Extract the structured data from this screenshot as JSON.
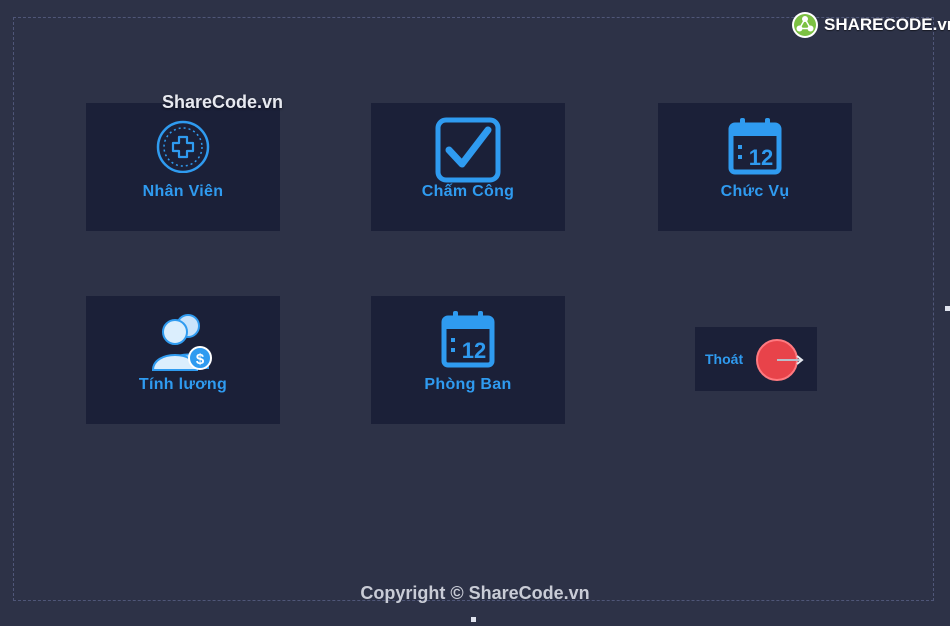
{
  "watermark": "ShareCode.vn",
  "logo": {
    "text": "SHARECODE.vn",
    "icon": "sharecode-logo-icon"
  },
  "tiles": [
    {
      "label": "Nhân Viên",
      "icon": "add-circle-icon"
    },
    {
      "label": "Chấm Công",
      "icon": "checkbox-icon"
    },
    {
      "label": "Chức Vụ",
      "icon": "calendar-icon"
    },
    {
      "label": "Tính lương",
      "icon": "users-salary-icon"
    },
    {
      "label": "Phòng Ban",
      "icon": "calendar-icon"
    }
  ],
  "calendar_day": "12",
  "exit": {
    "label": "Thoát",
    "icon": "exit-icon"
  },
  "copyright": "Copyright © ShareCode.vn",
  "colors": {
    "background": "#2d3247",
    "tile": "#1b2038",
    "accent": "#2f9bf0",
    "exit": "#e8434a"
  }
}
